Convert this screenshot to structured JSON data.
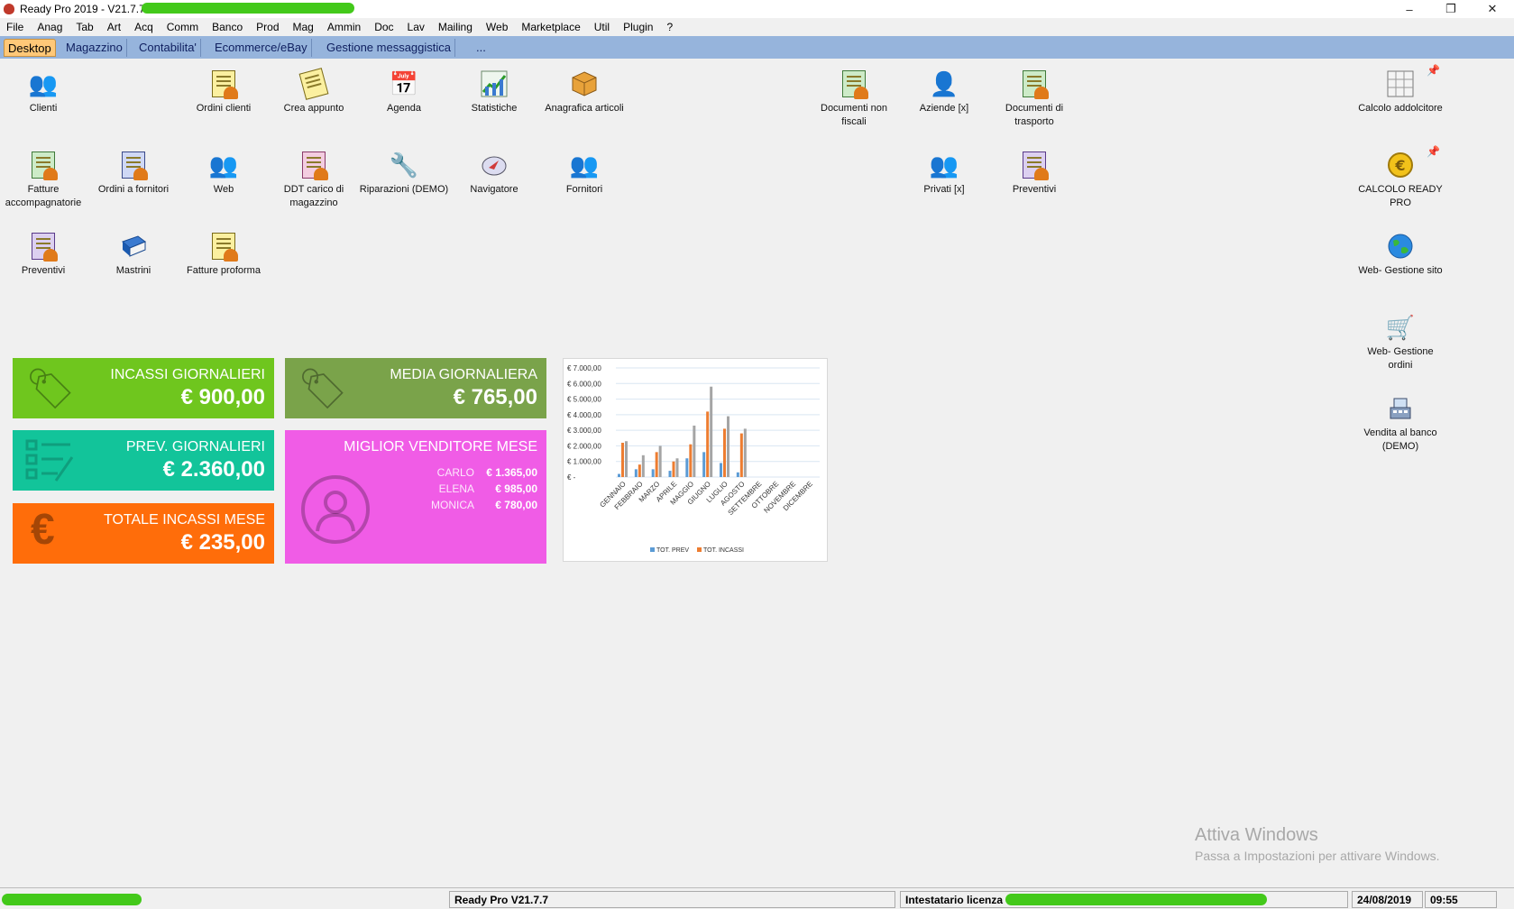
{
  "window": {
    "title": "Ready Pro 2019 - V21.7.7 -",
    "minimize": "–",
    "restore": "❐",
    "close": "✕"
  },
  "menu": [
    "File",
    "Anag",
    "Tab",
    "Art",
    "Acq",
    "Comm",
    "Banco",
    "Prod",
    "Mag",
    "Ammin",
    "Doc",
    "Lav",
    "Mailing",
    "Web",
    "Marketplace",
    "Util",
    "Plugin",
    "?"
  ],
  "tabs": [
    "Desktop",
    "Magazzino",
    "Contabilita'",
    "Ecommerce/eBay",
    "Gestione messaggistica",
    "..."
  ],
  "desktop_icons": {
    "clienti": "Clienti",
    "ordini_clienti": "Ordini clienti",
    "crea_appunto": "Crea appunto",
    "agenda": "Agenda",
    "statistiche": "Statistiche",
    "anagrafica_articoli": "Anagrafica articoli",
    "documenti_non_fiscali_1": "Documenti non",
    "documenti_non_fiscali_2": "fiscali",
    "aziende": "Aziende [x]",
    "documenti_trasporto_1": "Documenti di",
    "documenti_trasporto_2": "trasporto",
    "calcolo_addolcitore": "Calcolo addolcitore",
    "fatture_acc_1": "Fatture",
    "fatture_acc_2": "accompagnatorie",
    "ordini_fornitori": "Ordini a fornitori",
    "web": "Web",
    "ddt_carico_1": "DDT carico di",
    "ddt_carico_2": "magazzino",
    "riparazioni": "Riparazioni (DEMO)",
    "navigatore": "Navigatore",
    "fornitori": "Fornitori",
    "privati": "Privati [x]",
    "preventivi_right": "Preventivi",
    "calcolo_ready_1": "CALCOLO READY",
    "calcolo_ready_2": "PRO",
    "preventivi_left": "Preventivi",
    "mastrini": "Mastrini",
    "fatture_proforma": "Fatture proforma",
    "web_gestione_sito": "Web- Gestione sito",
    "web_gestione_ordini_1": "Web- Gestione",
    "web_gestione_ordini_2": "ordini",
    "vendita_banco_1": "Vendita al banco",
    "vendita_banco_2": "(DEMO)"
  },
  "tiles": {
    "incassi": {
      "title": "INCASSI GIORNALIERI",
      "value": "€ 900,00",
      "color": "#6fc61e"
    },
    "media": {
      "title": "MEDIA GIORNALIERA",
      "value": "€ 765,00",
      "color": "#7aa34a"
    },
    "prev": {
      "title": "PREV. GIORNALIERI",
      "value": "€ 2.360,00",
      "color": "#12c49a"
    },
    "totale": {
      "title": "TOTALE INCASSI MESE",
      "value": "€ 235,00",
      "color": "#ff6d0a"
    },
    "venditore": {
      "title": "MIGLIOR VENDITORE MESE",
      "color": "#f05ce6",
      "rows": [
        {
          "name": "CARLO",
          "value": "€ 1.365,00"
        },
        {
          "name": "ELENA",
          "value": "€ 985,00"
        },
        {
          "name": "MONICA",
          "value": "€ 780,00"
        }
      ]
    }
  },
  "chart_data": {
    "type": "bar",
    "categories": [
      "GENNAIO",
      "FEBBRAIO",
      "MARZO",
      "APRILE",
      "MAGGIO",
      "GIUGNO",
      "LUGLIO",
      "AGOSTO",
      "SETTEMBRE",
      "OTTOBRE",
      "NOVEMBRE",
      "DICEMBRE"
    ],
    "y_tick_labels": [
      "€ 7.000,00",
      "€ 6.000,00",
      "€ 5.000,00",
      "€ 4.000,00",
      "€ 3.000,00",
      "€ 2.000,00",
      "€ 1.000,00",
      "€ -"
    ],
    "ylim": [
      0,
      7000
    ],
    "series": [
      {
        "name": "TOT. PREV",
        "color": "#5b9bd5",
        "values": [
          200,
          500,
          500,
          400,
          1200,
          1600,
          900,
          300,
          0,
          0,
          0,
          0
        ]
      },
      {
        "name": "TOT. INCASSI",
        "color": "#ed7d31",
        "values": [
          2200,
          800,
          1600,
          1000,
          2100,
          4200,
          3100,
          2800,
          0,
          0,
          0,
          0
        ]
      },
      {
        "name": "",
        "color": "#a5a5a5",
        "values": [
          2300,
          1400,
          2000,
          1200,
          3300,
          5800,
          3900,
          3100,
          0,
          0,
          0,
          0
        ]
      }
    ],
    "legend": "bottom",
    "grid": true
  },
  "status": {
    "version": "Ready Pro V21.7.7",
    "license": "Intestatario licenza",
    "date": "24/08/2019",
    "time": "09:55"
  },
  "watermark": {
    "line1": "Attiva Windows",
    "line2": "Passa a Impostazioni per attivare Windows."
  }
}
